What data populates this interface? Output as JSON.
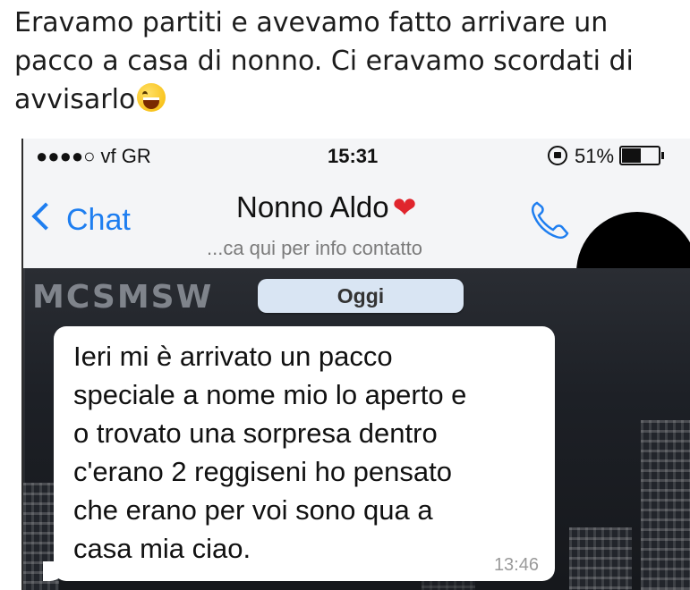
{
  "post": {
    "caption": "Eravamo partiti e avevamo fatto arrivare un pacco a casa di nonno. Ci eravamo scordati di avvisarlo"
  },
  "status_bar": {
    "carrier": "●●●●○ vf GR",
    "time": "15:31",
    "battery_percent": "51%",
    "battery_level": 0.51
  },
  "nav": {
    "back_label": "Chat",
    "contact_name": "Nonno Aldo",
    "contact_subtitle": "...ca qui per info contatto",
    "heart": "❤"
  },
  "chat": {
    "watermark": "MCSMSW",
    "date_divider": "Oggi",
    "messages": [
      {
        "text": "Ieri mi è arrivato un pacco\nspeciale a nome mio lo aperto e\no trovato una sorpresa dentro\nc'erano 2 reggiseni ho pensato\nche erano per voi sono qua a\ncasa mia ciao.",
        "time": "13:46"
      }
    ]
  },
  "colors": {
    "accent": "#1e7ef0",
    "heart": "#e0252d",
    "date_pill": "#d9e5f3"
  },
  "icons": [
    "chevron-left-icon",
    "phone-icon",
    "lock-rotation-icon",
    "battery-icon",
    "laughing-emoji-icon"
  ]
}
